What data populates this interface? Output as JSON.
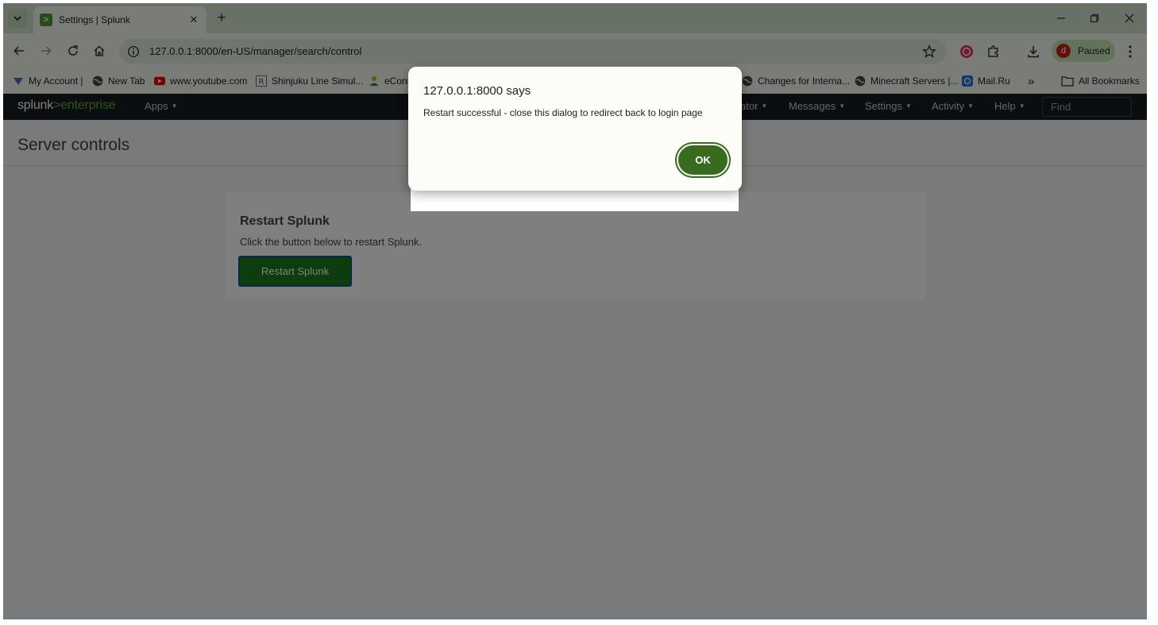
{
  "browser": {
    "tab": {
      "title": "Settings | Splunk",
      "favicon": ">"
    },
    "profile": {
      "initial": "d",
      "label": "Paused"
    },
    "url": "127.0.0.1:8000/en-US/manager/search/control",
    "bookmarks": [
      {
        "label": "My Account |",
        "icon": "account-icon"
      },
      {
        "label": "New Tab",
        "icon": "globe-icon"
      },
      {
        "label": "www.youtube.com",
        "icon": "youtube-icon"
      },
      {
        "label": "Shinjuku Line Simul...",
        "icon": "r-icon"
      },
      {
        "label": "eConn",
        "icon": "person-icon"
      },
      {
        "label": "Changes for Interna...",
        "icon": "globe-icon"
      },
      {
        "label": "Minecraft Servers |...",
        "icon": "globe-icon"
      },
      {
        "label": "Mail.Ru",
        "icon": "mail-icon"
      }
    ],
    "bookmarks_overflow": "»",
    "all_bookmarks": "All Bookmarks"
  },
  "splunk": {
    "logo_a": "splunk",
    "logo_gt": ">",
    "logo_b": "enterprise",
    "nav": {
      "apps": "Apps",
      "administrator_partial": "ator",
      "messages": "Messages",
      "settings": "Settings",
      "activity": "Activity",
      "help": "Help"
    },
    "find_placeholder": "Find",
    "page_title": "Server controls",
    "card": {
      "title": "Restart Splunk",
      "text": "Click the button below to restart Splunk.",
      "button": "Restart Splunk"
    }
  },
  "dialog": {
    "title": "127.0.0.1:8000 says",
    "message": "Restart successful - close this dialog to redirect back to login page",
    "ok": "OK"
  },
  "colors": {
    "accent_green": "#386a20",
    "splunk_green": "#65a637",
    "nav_bg": "#171d21"
  }
}
